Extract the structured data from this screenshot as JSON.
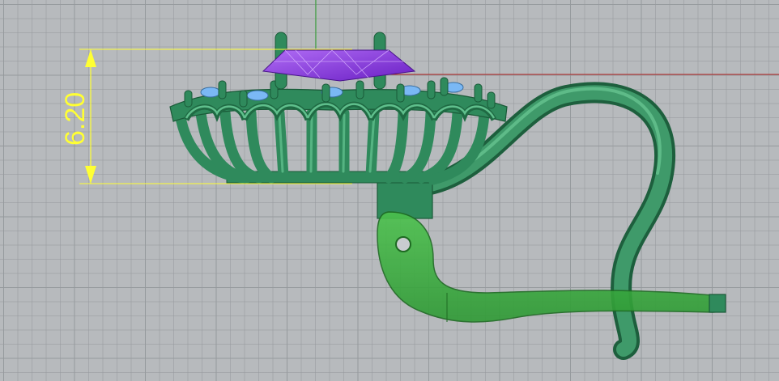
{
  "viewport": {
    "name": "Front",
    "background_color": "#b7babd",
    "grid_color": "#9a9ea2"
  },
  "axes": {
    "x_axis_color": "#b02020",
    "y_axis_color": "#2aa02a"
  },
  "dimension": {
    "value_text": "6.20",
    "color": "#ffff33"
  },
  "model": {
    "metal_color": "#2f8a5c",
    "metal_highlight": "#4fb07c",
    "metal_selected_color": "#38a83a",
    "gem_center_color": "#8a2be2",
    "gem_side_color": "#7ab8f5",
    "icons": [
      "ring-head-basket",
      "center-gem",
      "side-gems",
      "prongs",
      "ear-wire-hook",
      "lever-back-clip"
    ]
  }
}
